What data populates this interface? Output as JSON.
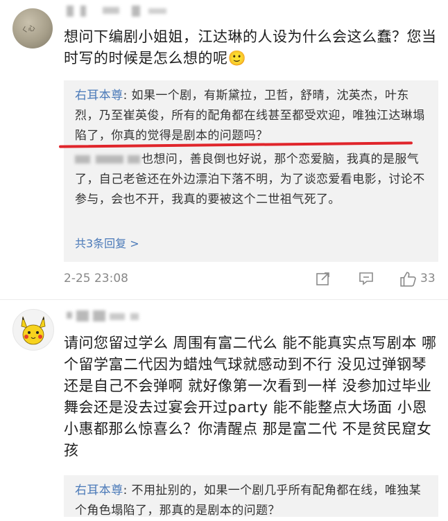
{
  "comments": [
    {
      "text": "想问下编剧小姐姐，江达琳的人设为什么会这么蠢？您当时写的时候是怎么想的呢🙂",
      "reply": {
        "name": "右耳本尊",
        "body": ": 如果一个剧，有斯黛拉，卫哲，舒晴，沈英杰，叶东烈，乃至崔英俊，所有的配角都在线甚至都受欢迎，唯独江达琳塌陷了，你真的觉得是剧本的问题吗？"
      },
      "second_reply": {
        "body": "也想问，善良倒也好说，那个恋爱脑，我真的是服气了，自己老爸还在外边漂泊下落不明，为了谈恋爱看电影，讨论不参与，会也不开，我真的要被这个二世祖气死了。"
      },
      "more_replies": "共3条回复 >",
      "timestamp": "2-25 23:08",
      "likes": "33",
      "avatar_label": "ㄑ心"
    },
    {
      "text": "请问您留过学么 周围有富二代么 能不能真实点写剧本 哪个留学富二代因为蜡烛气球就感动到不行 没见过弹钢琴还是自己不会弹啊 就好像第一次看到一样 没参加过毕业舞会还是没去过宴会开过party 能不能整点大场面 小恩小惠都那么惊喜么？你清醒点 那是富二代 不是贫民窟女孩",
      "reply": {
        "name": "右耳本尊",
        "body": ": 不用扯别的，如果一个剧几乎所有配角都在线，唯独某个角色塌陷了，那真的是剧本的问题？"
      }
    }
  ],
  "icons": {
    "share": "share-icon",
    "comment": "comment-icon",
    "like": "thumbs-up-icon"
  },
  "colors": {
    "link": "#4a79b8",
    "highlight_line": "#e0252b"
  }
}
